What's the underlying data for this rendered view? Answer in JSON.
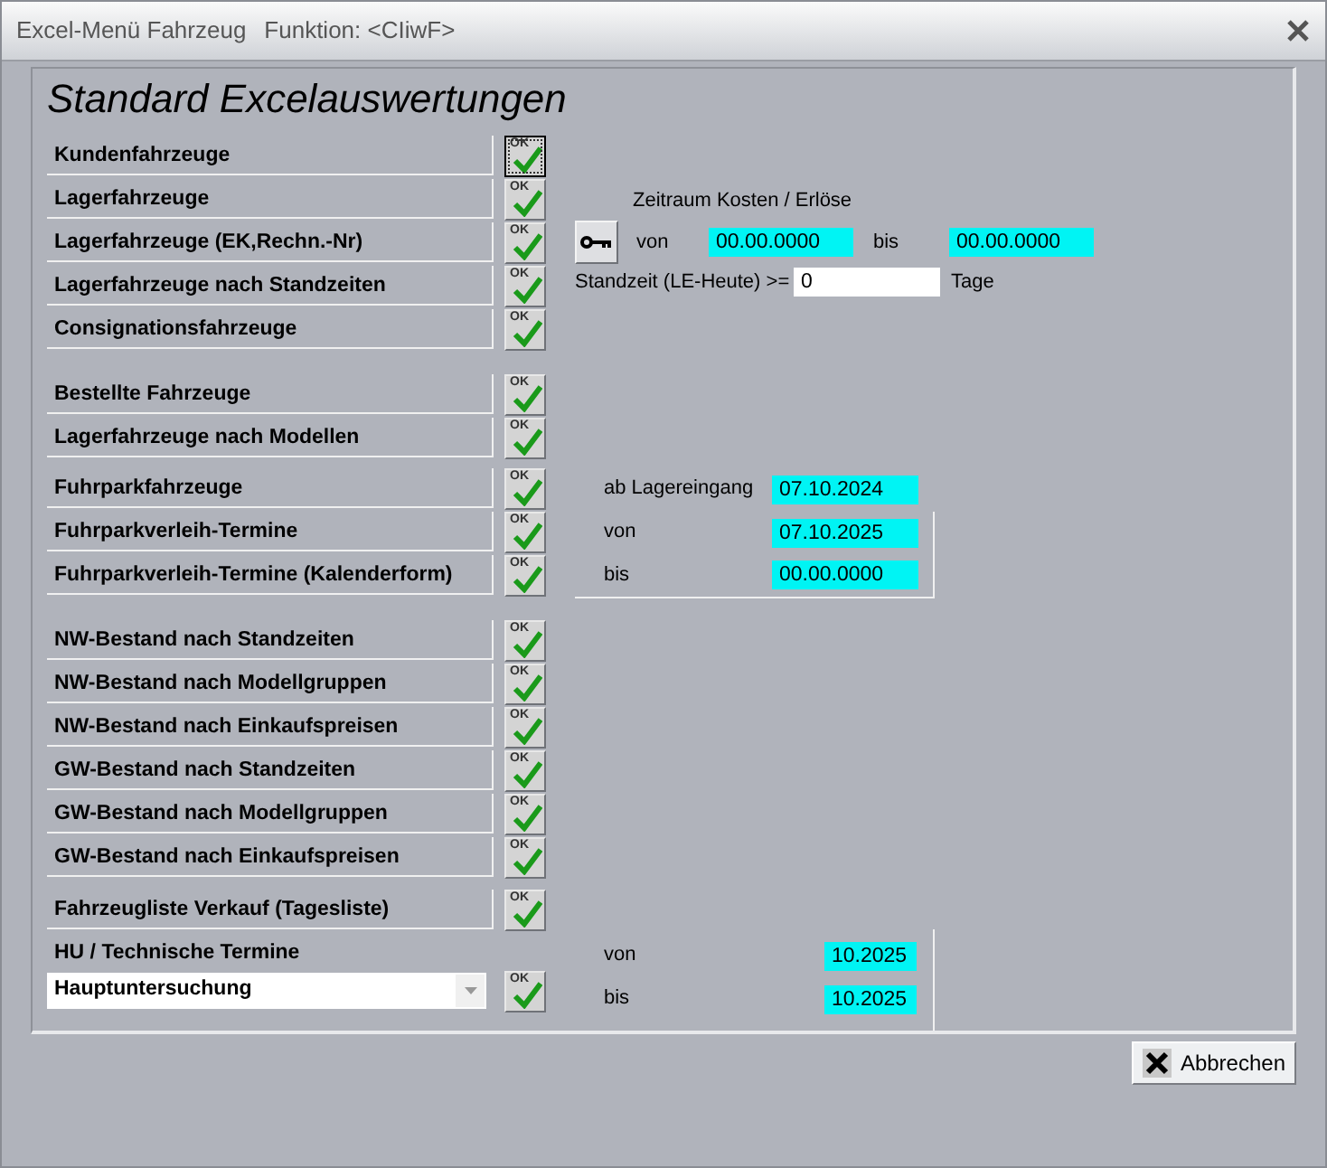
{
  "window": {
    "title": "Excel-Menü Fahrzeug",
    "function": "Funktion: <CIiwF>"
  },
  "heading": "Standard Excelauswertungen",
  "report_groups": [
    [
      {
        "label": "Kundenfahrzeuge",
        "button": "OK",
        "focused": true
      },
      {
        "label": "Lagerfahrzeuge",
        "button": "OK",
        "focused": false
      },
      {
        "label": "Lagerfahrzeuge (EK,Rechn.-Nr)",
        "button": "OK",
        "focused": false
      },
      {
        "label": "Lagerfahrzeuge nach Standzeiten",
        "button": "OK",
        "focused": false
      },
      {
        "label": "Consignationsfahrzeuge",
        "button": "OK",
        "focused": false
      }
    ],
    [
      {
        "label": "Bestellte Fahrzeuge",
        "button": "OK",
        "focused": false
      },
      {
        "label": "Lagerfahrzeuge nach Modellen",
        "button": "OK",
        "focused": false
      }
    ],
    [
      {
        "label": "Fuhrparkfahrzeuge",
        "button": "OK",
        "focused": false
      },
      {
        "label": "Fuhrparkverleih-Termine",
        "button": "OK",
        "focused": false
      },
      {
        "label": "Fuhrparkverleih-Termine (Kalenderform)",
        "button": "OK",
        "focused": false
      }
    ],
    [
      {
        "label": "NW-Bestand nach Standzeiten",
        "button": "OK",
        "focused": false
      },
      {
        "label": "NW-Bestand nach Modellgruppen",
        "button": "OK",
        "focused": false
      },
      {
        "label": "NW-Bestand nach Einkaufspreisen",
        "button": "OK",
        "focused": false
      },
      {
        "label": "GW-Bestand nach Standzeiten",
        "button": "OK",
        "focused": false
      },
      {
        "label": "GW-Bestand nach Modellgruppen",
        "button": "OK",
        "focused": false
      },
      {
        "label": "GW-Bestand nach Einkaufspreisen",
        "button": "OK",
        "focused": false
      }
    ],
    [
      {
        "label": "Fahrzeugliste Verkauf (Tagesliste)",
        "button": "OK",
        "focused": false
      }
    ]
  ],
  "hu": {
    "label": "HU / Technische Termine",
    "select": "Hauptuntersuchung",
    "button": "OK",
    "focused": false
  },
  "zeitraum": {
    "title": "Zeitraum Kosten / Erlöse",
    "von_label": "von",
    "von": "00.00.0000",
    "bis_label": "bis",
    "bis": "00.00.0000",
    "standzeit_label": "Standzeit (LE-Heute) >=",
    "standzeit": "0",
    "tage": "Tage"
  },
  "fuhrpark": [
    {
      "label": "ab Lagereingang",
      "value": "07.10.2024"
    },
    {
      "label": "von",
      "value": "07.10.2025"
    },
    {
      "label": "bis",
      "value": "00.00.0000"
    }
  ],
  "hu_dates": [
    {
      "label": "von",
      "value": "10.2025"
    },
    {
      "label": "bis",
      "value": "10.2025"
    }
  ],
  "cancel": "Abbrechen"
}
